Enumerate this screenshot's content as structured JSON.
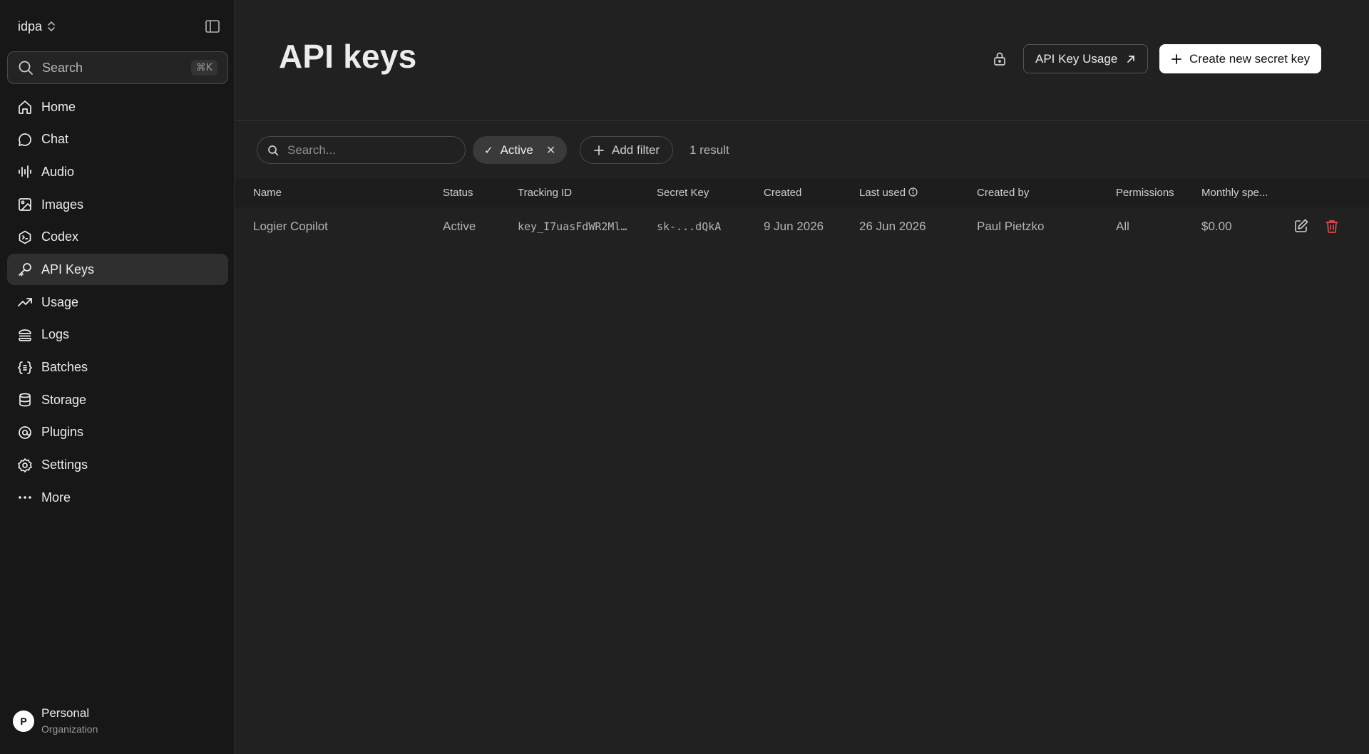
{
  "org": {
    "name": "idpa"
  },
  "sidebar": {
    "search_label": "Search",
    "search_shortcut": "⌘K",
    "items": [
      {
        "label": "Home",
        "icon": "home-icon"
      },
      {
        "label": "Chat",
        "icon": "chat-icon"
      },
      {
        "label": "Audio",
        "icon": "audio-icon"
      },
      {
        "label": "Images",
        "icon": "image-icon"
      },
      {
        "label": "Codex",
        "icon": "codex-icon"
      },
      {
        "label": "API Keys",
        "icon": "key-icon",
        "active": true
      },
      {
        "label": "Usage",
        "icon": "trend-icon"
      },
      {
        "label": "Logs",
        "icon": "logs-icon"
      },
      {
        "label": "Batches",
        "icon": "batches-icon"
      },
      {
        "label": "Storage",
        "icon": "database-icon"
      },
      {
        "label": "Plugins",
        "icon": "plugin-icon"
      },
      {
        "label": "Settings",
        "icon": "gear-icon"
      },
      {
        "label": "More",
        "icon": "more-icon"
      }
    ],
    "profile": {
      "initial": "P",
      "name": "Personal",
      "subtitle": "Organization"
    }
  },
  "header": {
    "title": "API keys",
    "usage_button": "API Key Usage",
    "create_button": "Create new secret key"
  },
  "filters": {
    "search_placeholder": "Search...",
    "active_chip": "Active",
    "add_filter": "Add filter",
    "result_count": "1 result"
  },
  "table": {
    "columns": [
      "Name",
      "Status",
      "Tracking ID",
      "Secret Key",
      "Created",
      "Last used",
      "Created by",
      "Permissions",
      "Monthly spe..."
    ],
    "rows": [
      {
        "name": "Logier Copilot",
        "status": "Active",
        "tracking_id": "key_I7uasFdWR2Ml…",
        "secret_key": "sk-...dQkA",
        "created": "9 Jun 2026",
        "last_used": "26 Jun 2026",
        "created_by": "Paul Pietzko",
        "permissions": "All",
        "monthly_spend": "$0.00"
      }
    ]
  },
  "colors": {
    "background": "#212121",
    "sidebar": "#171717",
    "delete": "#e5484d"
  }
}
